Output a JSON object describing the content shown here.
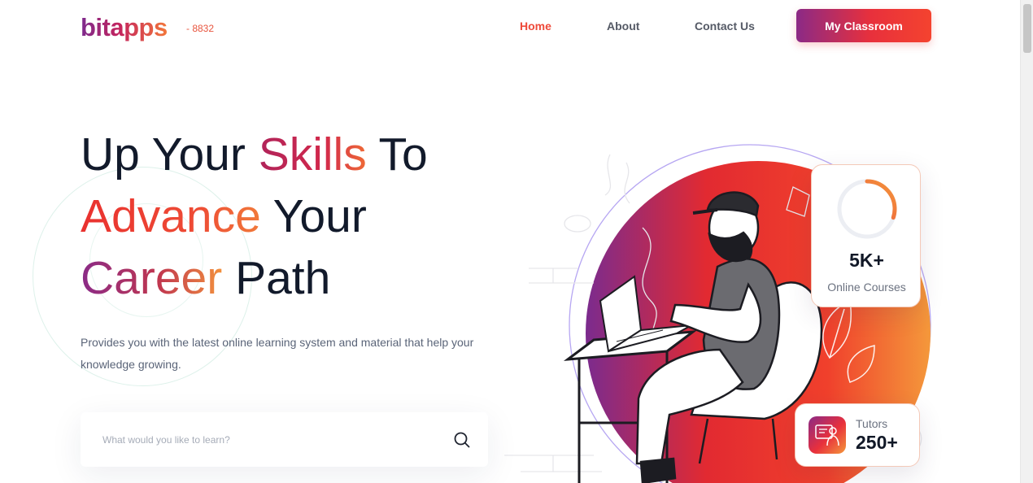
{
  "brand": {
    "name": "bitapps",
    "suffix": "- 8832"
  },
  "nav": {
    "items": [
      {
        "label": "Home",
        "active": true
      },
      {
        "label": "About",
        "active": false
      },
      {
        "label": "Contact Us",
        "active": false
      }
    ],
    "cta_label": "My Classroom"
  },
  "hero": {
    "line1_a": "Up Your ",
    "line1_b": "Skills",
    "line1_c": " To",
    "line2_a": "Advance",
    "line2_b": " Your",
    "line3_a": "Career",
    "line3_b": " Path",
    "description": "Provides you with the latest online learning system and material that help your knowledge growing."
  },
  "search": {
    "placeholder": "What would you like to learn?",
    "icon": "search-icon"
  },
  "stats": {
    "courses": {
      "value": "5K+",
      "label": "Online Courses",
      "ring_progress": 0.3
    },
    "tutors": {
      "label": "Tutors",
      "value": "250+",
      "icon": "tutor-icon"
    }
  },
  "colors": {
    "accent": "#ee4a3a",
    "gradient_start": "#8b2a86",
    "gradient_end": "#f4432f",
    "text": "#121a2b"
  }
}
